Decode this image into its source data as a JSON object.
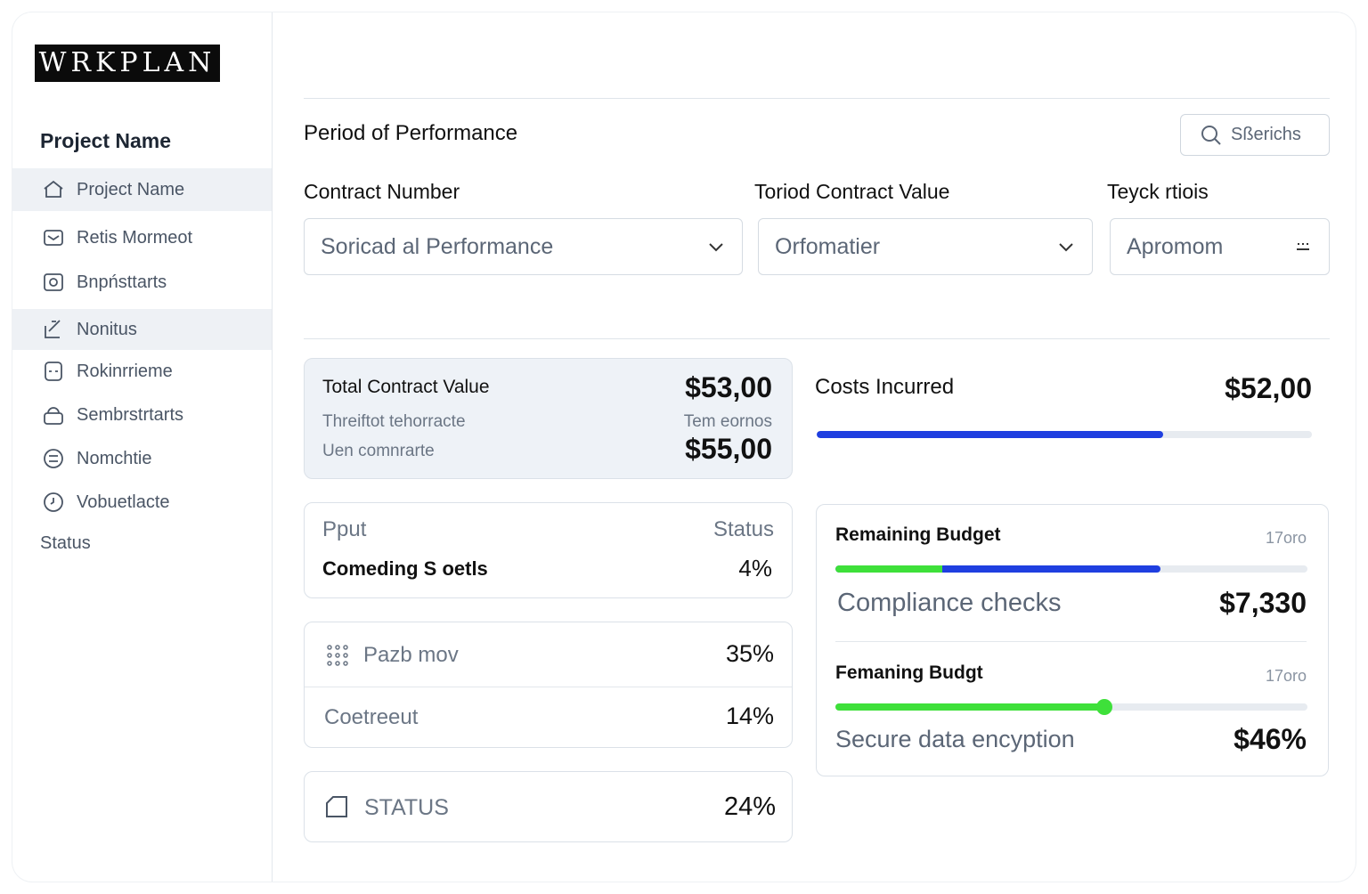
{
  "logo": "WRKPLAN",
  "sidebar": {
    "heading": "Project Name",
    "items": [
      {
        "label": "Project Name",
        "icon": "home-icon"
      },
      {
        "label": "Retis Mormeot",
        "icon": "mail-icon"
      },
      {
        "label": "Bnpństtarts",
        "icon": "camera-icon"
      },
      {
        "label": "Nonitus",
        "icon": "edit-icon"
      },
      {
        "label": "Rokinrrieme",
        "icon": "chat-icon"
      },
      {
        "label": "Sembrstrtarts",
        "icon": "lock-icon"
      },
      {
        "label": "Nomchtie",
        "icon": "list-icon"
      },
      {
        "label": "Vobuetlacte",
        "icon": "clock-icon"
      }
    ],
    "status": "Status"
  },
  "header": {
    "title": "Period of Performance",
    "search": "Sßerichs"
  },
  "filters": [
    {
      "label": "Contract Number",
      "value": "Soricad al Performance"
    },
    {
      "label": "Toriod Contract Value",
      "value": "Orfomatier"
    },
    {
      "label": "Teyck rtiois",
      "value": "Apromom"
    }
  ],
  "tcv": {
    "label": "Total Contract Value",
    "value": "$53,00",
    "sub1": "Threiftot tehorracte",
    "sub1_right": "Tem eornos",
    "sub2": "Uen comnrarte",
    "value2": "$55,00"
  },
  "costs": {
    "label": "Costs Incurred",
    "value": "$52,00",
    "progress": 70
  },
  "pput": {
    "label": "Pput",
    "status": "Status",
    "row": "Comeding S oetls",
    "value": "4%"
  },
  "list": [
    {
      "label": "Pazb mov",
      "value": "35%"
    },
    {
      "label": "Coetreeut",
      "value": "14%"
    }
  ],
  "statusCard": {
    "label": "STATUS",
    "value": "24%"
  },
  "budget": [
    {
      "label": "Remaining Budget",
      "meta": "17oro",
      "green": 22.7,
      "blue": 68.8,
      "sub": "Compliance checks",
      "value": "$7,330"
    },
    {
      "label": "Femaning Budgt",
      "meta": "17oro",
      "green": 56.9,
      "sub": "Secure data encyption",
      "value": "$46%"
    }
  ],
  "colors": {
    "blue": "#1f3fe0",
    "green": "#3ee03a"
  }
}
